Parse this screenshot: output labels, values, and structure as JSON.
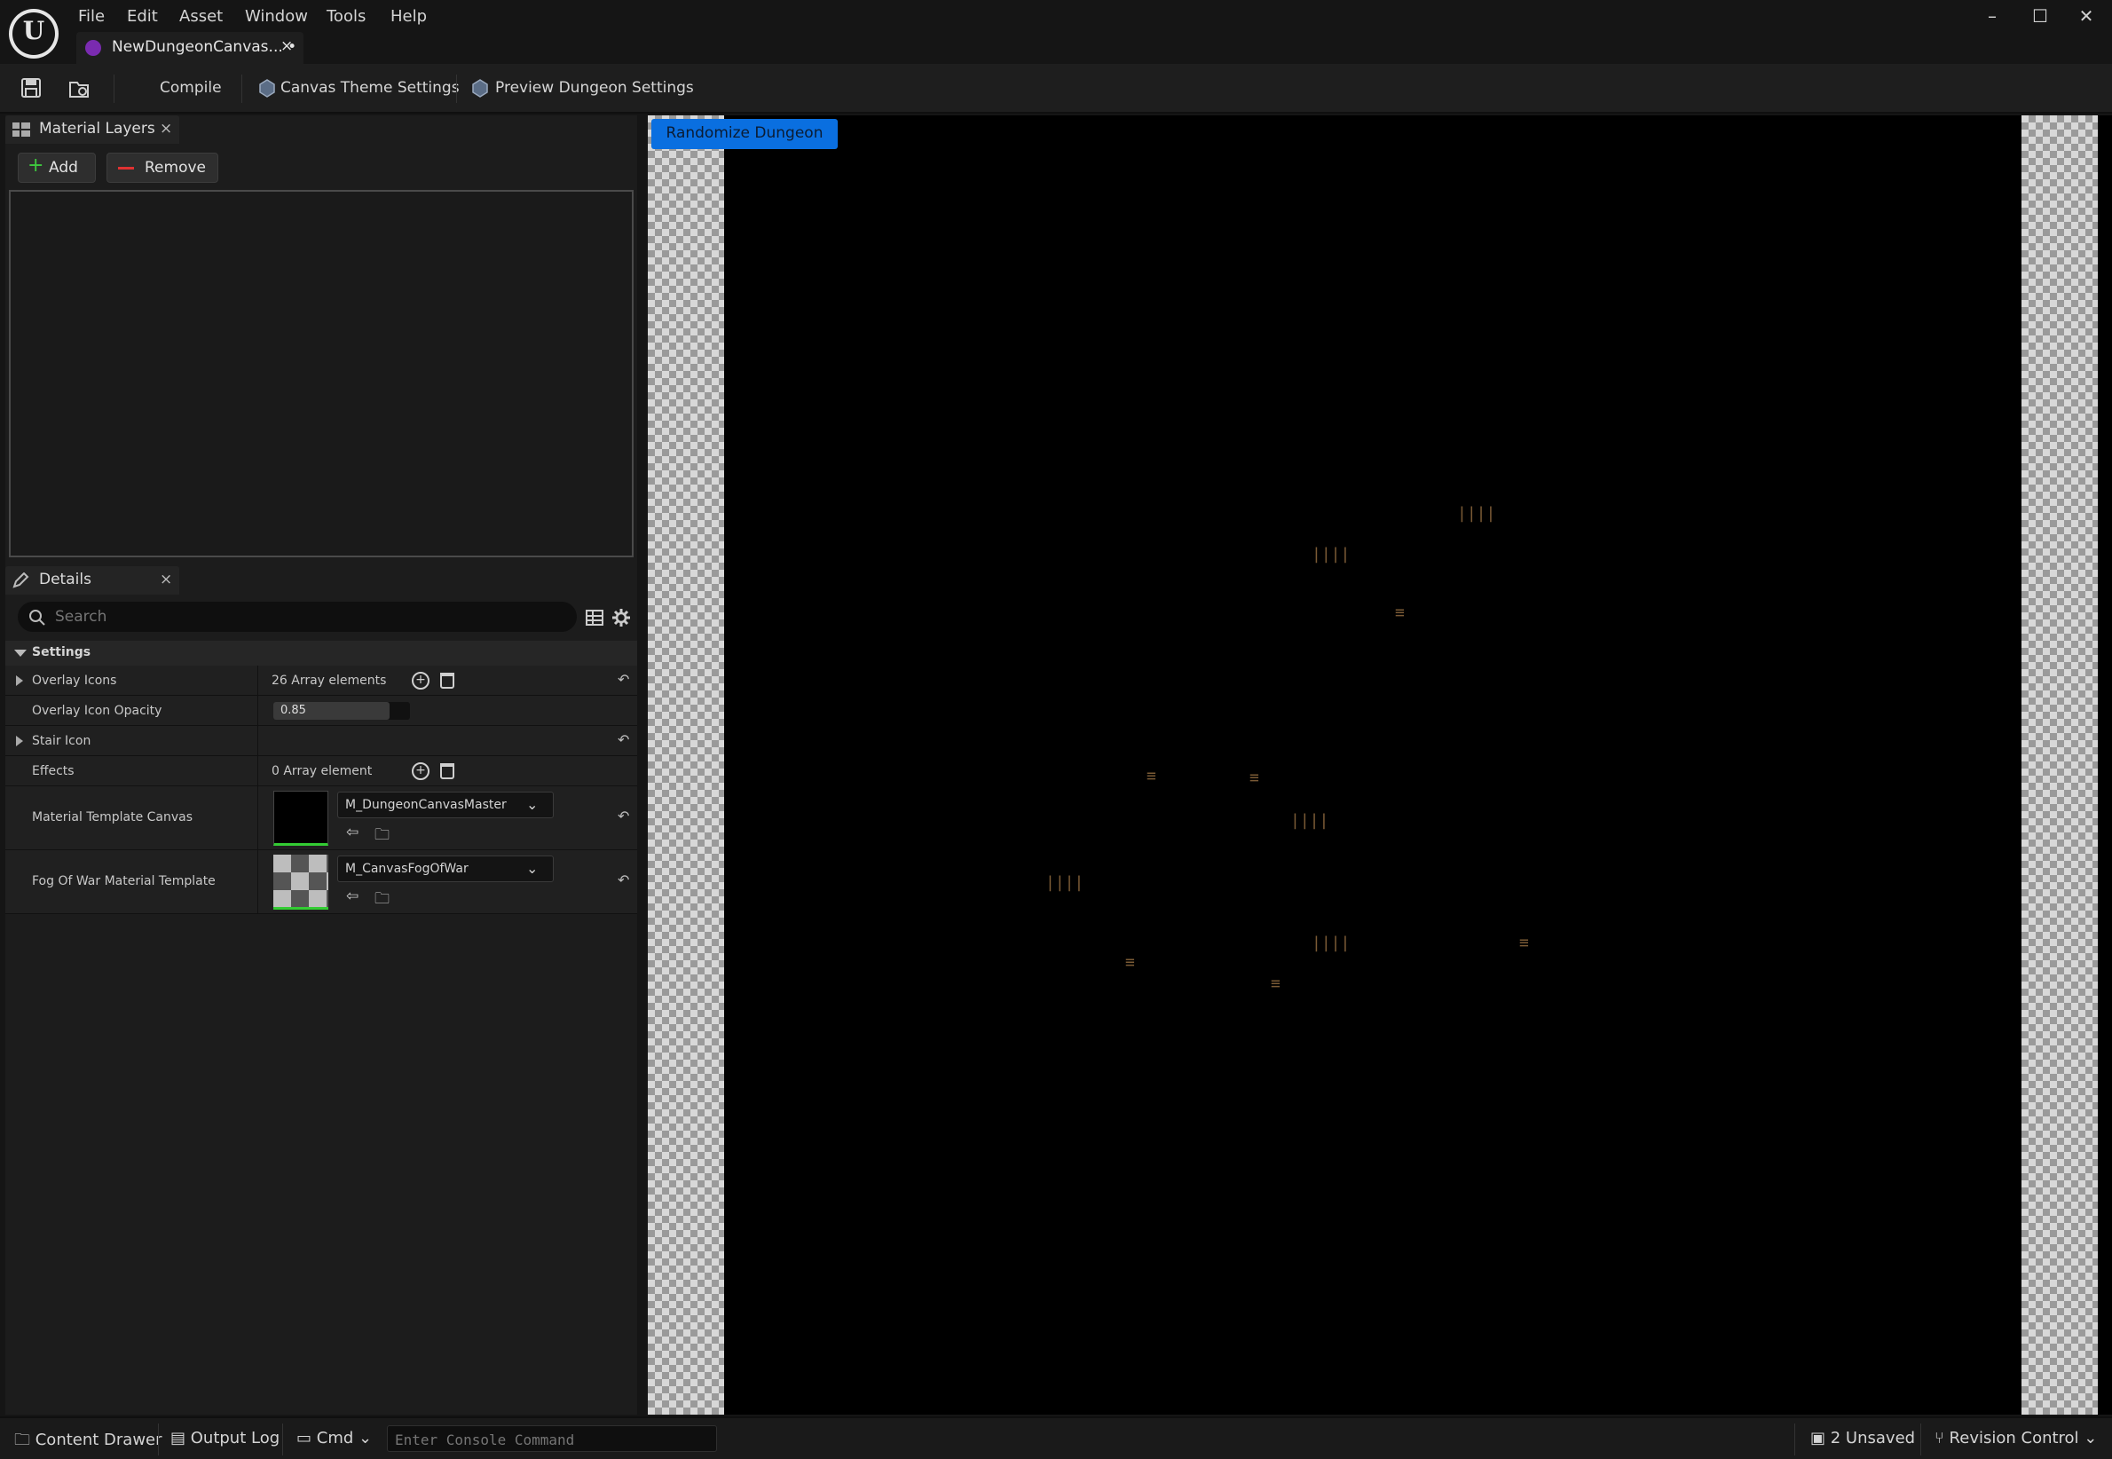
{
  "app": {
    "logo_text": "U",
    "menu": [
      "File",
      "Edit",
      "Asset",
      "Window",
      "Tools",
      "Help"
    ],
    "document_tab": {
      "label": "NewDungeonCanvas... •",
      "close": "×"
    },
    "window_controls": {
      "minimize": "–",
      "maximize": "☐",
      "close": "✕"
    }
  },
  "toolbar": {
    "compile": "Compile",
    "canvas_theme": "Canvas Theme Settings",
    "preview_dungeon": "Preview Dungeon Settings"
  },
  "material_layers": {
    "title": "Material Layers",
    "close": "×",
    "add": "Add",
    "remove": "Remove"
  },
  "details": {
    "title": "Details",
    "close": "×",
    "search_placeholder": "Search",
    "section": "Settings",
    "rows": {
      "overlay_icons": {
        "name": "Overlay Icons",
        "value": "26 Array elements"
      },
      "overlay_opacity": {
        "name": "Overlay Icon Opacity",
        "value": "0.85",
        "fraction": 0.85
      },
      "stair_icon": {
        "name": "Stair Icon"
      },
      "effects": {
        "name": "Effects",
        "value": "0 Array element"
      },
      "material_template": {
        "name": "Material Template Canvas",
        "asset": "M_DungeonCanvasMaster"
      },
      "fog_of_war": {
        "name": "Fog Of War Material Template",
        "asset": "M_CanvasFogOfWar"
      }
    }
  },
  "viewport": {
    "randomize_button": "Randomize Dungeon",
    "stair_glyph_vertical": "||||",
    "stair_glyph_horizontal": "≡"
  },
  "statusbar": {
    "content_drawer": "Content Drawer",
    "output_log": "Output Log",
    "cmd": "Cmd",
    "console_placeholder": "Enter Console Command",
    "unsaved": "2 Unsaved",
    "revision_control": "Revision Control"
  },
  "colors": {
    "accent_blue": "#0a6fe0",
    "asset_border_green": "#33cc33",
    "stair_brown": "#7a5a35"
  }
}
